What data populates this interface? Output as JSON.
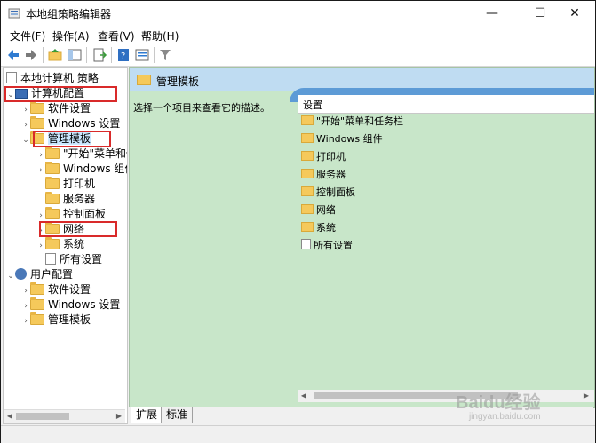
{
  "window": {
    "title": "本地组策略编辑器",
    "minimize": "—",
    "maximize": "☐",
    "close": "✕"
  },
  "menu": [
    "文件(F)",
    "操作(A)",
    "查看(V)",
    "帮助(H)"
  ],
  "tree": {
    "root": "本地计算机 策略",
    "computer_config": "计算机配置",
    "software_settings": "软件设置",
    "windows_settings": "Windows 设置",
    "admin_templates": "管理模板",
    "start_menu": "\"开始\"菜单和任",
    "windows_components": "Windows 组件",
    "printers": "打印机",
    "server": "服务器",
    "control_panel": "控制面板",
    "network": "网络",
    "system": "系统",
    "all_settings": "所有设置",
    "user_config": "用户配置",
    "user_software_settings": "软件设置",
    "user_windows_settings": "Windows 设置",
    "user_admin_templates": "管理模板"
  },
  "right": {
    "header_title": "管理模板",
    "description": "选择一个项目来查看它的描述。",
    "column_header": "设置",
    "items": [
      "\"开始\"菜单和任务栏",
      "Windows 组件",
      "打印机",
      "服务器",
      "控制面板",
      "网络",
      "系统",
      "所有设置"
    ]
  },
  "tabs": {
    "extended": "扩展",
    "standard": "标准"
  },
  "watermark": {
    "brand": "Baidu经验",
    "sub": "jingyan.baidu.com"
  },
  "colors": {
    "highlight": "#d92a2a",
    "pane_bg": "#c8e6c9",
    "header_bg": "#bfdcf2",
    "accent": "#5d9bd6"
  }
}
